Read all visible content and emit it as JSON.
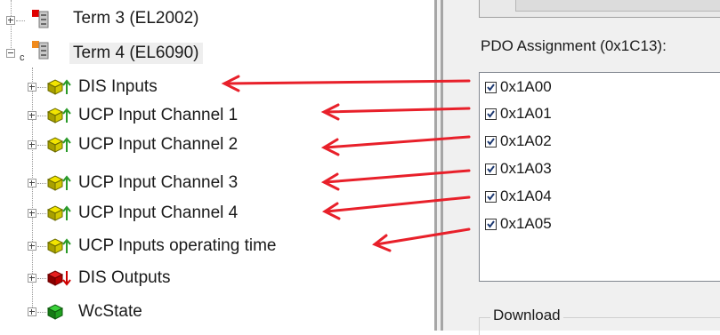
{
  "tree": {
    "term3": {
      "label": "Term 3 (EL2002)",
      "icon": "terminal-icon-red"
    },
    "term4": {
      "label": "Term 4 (EL6090)",
      "icon": "terminal-icon-orange"
    },
    "children": [
      {
        "label": "DIS Inputs",
        "icon": "input-icon"
      },
      {
        "label": "UCP Input Channel 1",
        "icon": "input-icon"
      },
      {
        "label": "UCP Input Channel 2",
        "icon": "input-icon"
      },
      {
        "label": "UCP Input Channel 3",
        "icon": "input-icon"
      },
      {
        "label": "UCP Input Channel 4",
        "icon": "input-icon"
      },
      {
        "label": "UCP Inputs operating time",
        "icon": "input-icon"
      },
      {
        "label": "DIS Outputs",
        "icon": "output-icon"
      },
      {
        "label": "WcState",
        "icon": "state-icon"
      }
    ]
  },
  "pdo": {
    "title": "PDO Assignment (0x1C13):",
    "items": [
      {
        "label": "0x1A00",
        "checked": true
      },
      {
        "label": "0x1A01",
        "checked": true
      },
      {
        "label": "0x1A02",
        "checked": true
      },
      {
        "label": "0x1A03",
        "checked": true
      },
      {
        "label": "0x1A04",
        "checked": true
      },
      {
        "label": "0x1A05",
        "checked": true
      }
    ]
  },
  "download": {
    "legend": "Download"
  },
  "colors": {
    "arrow": "#e8202a",
    "checkmark": "#1f3b73",
    "tree_text": "#1a1a1a"
  }
}
